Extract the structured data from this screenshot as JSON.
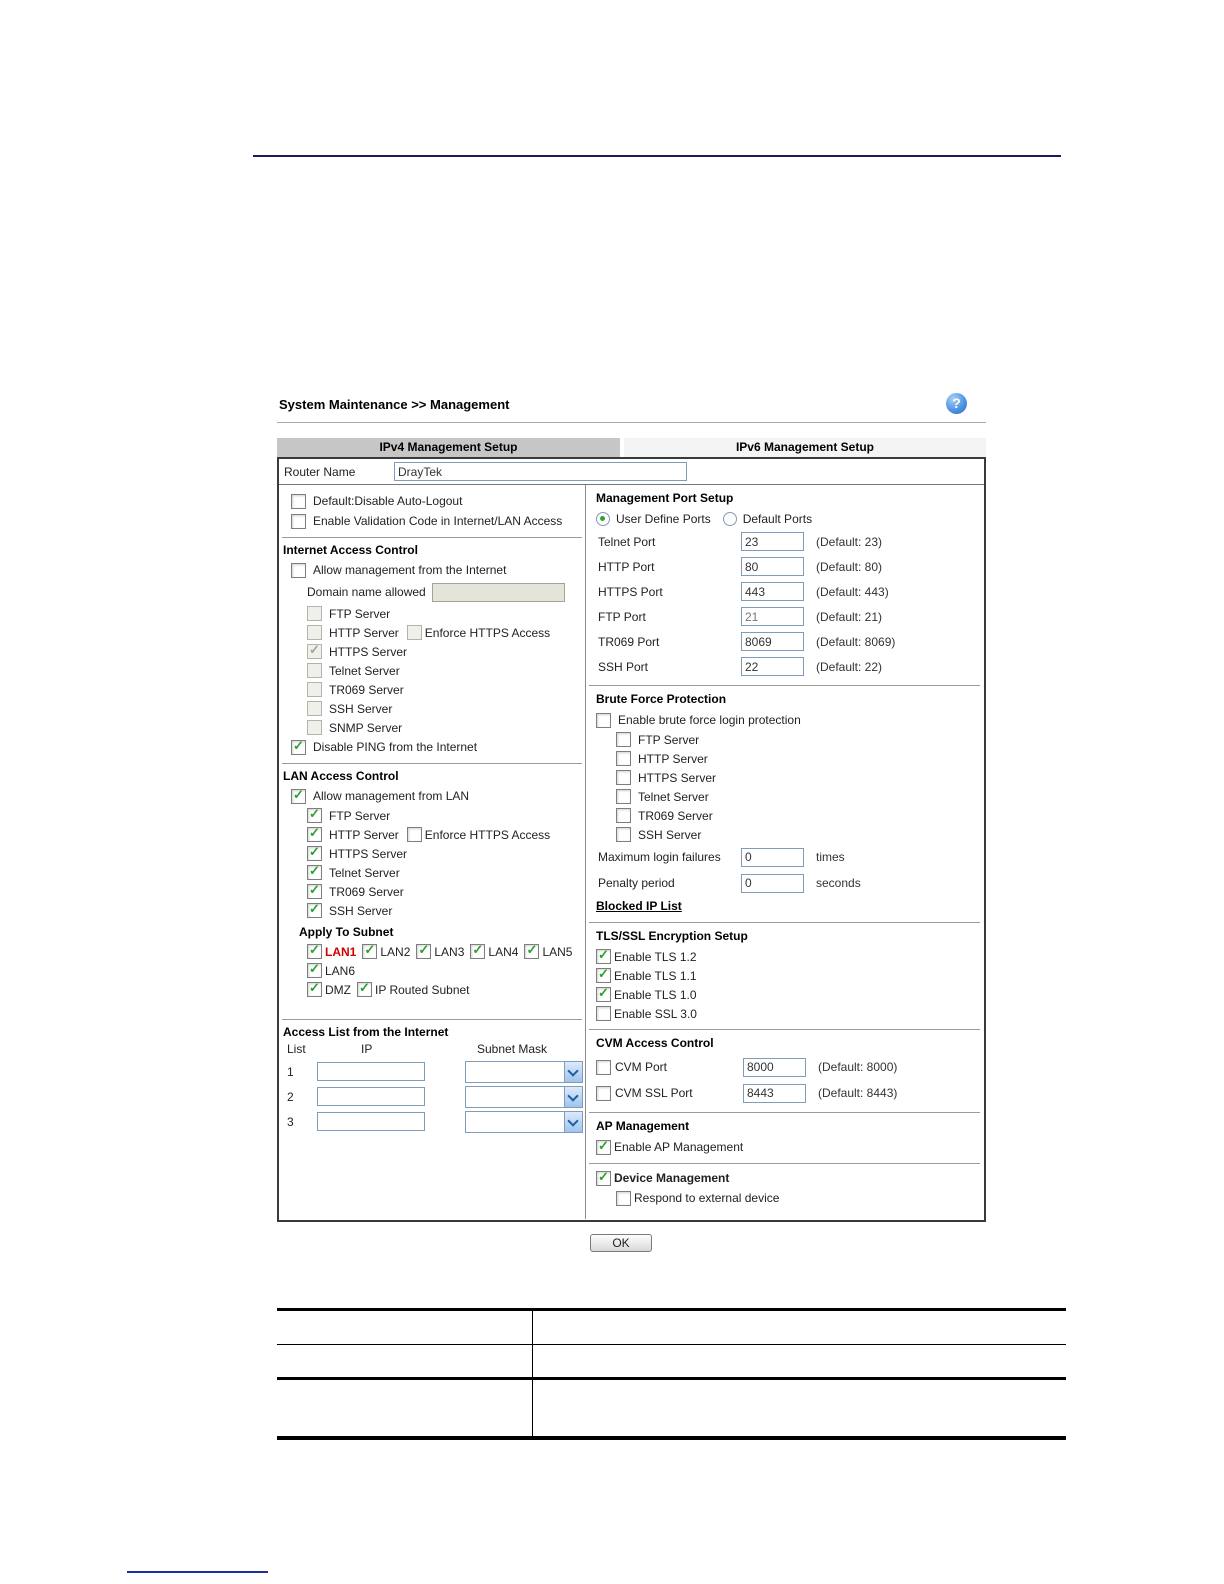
{
  "app": {
    "breadcrumb": "System Maintenance >> Management",
    "help": "?",
    "tabs": [
      {
        "label": "IPv4 Management Setup",
        "active": true
      },
      {
        "label": "IPv6 Management Setup",
        "active": false
      }
    ],
    "router_name": {
      "label": "Router Name",
      "value": "DrayTek"
    },
    "left": {
      "top_options": [
        {
          "label": "Default:Disable Auto-Logout",
          "checked": false
        },
        {
          "label": "Enable Validation Code in Internet/LAN Access",
          "checked": false
        }
      ],
      "internet_access": {
        "title": "Internet Access Control",
        "allow_label": "Allow management from the Internet",
        "allow_checked": false,
        "domain_label": "Domain name allowed",
        "domain_value": "",
        "servers": [
          {
            "label": "FTP Server",
            "checked": false,
            "disabled": true
          },
          {
            "label": "HTTP Server",
            "checked": false,
            "disabled": true,
            "extra": "Enforce HTTPS Access",
            "extra_checked": false
          },
          {
            "label": "HTTPS Server",
            "checked": true,
            "disabled": true
          },
          {
            "label": "Telnet Server",
            "checked": false,
            "disabled": true
          },
          {
            "label": "TR069 Server",
            "checked": false,
            "disabled": true
          },
          {
            "label": "SSH Server",
            "checked": false,
            "disabled": true
          },
          {
            "label": "SNMP Server",
            "checked": false,
            "disabled": true
          }
        ],
        "disable_ping_label": "Disable PING from the Internet",
        "disable_ping_checked": true
      },
      "lan_access": {
        "title": "LAN Access Control",
        "allow_label": "Allow management from LAN",
        "allow_checked": true,
        "servers": [
          {
            "label": "FTP Server",
            "checked": true
          },
          {
            "label": "HTTP Server",
            "checked": true,
            "extra": "Enforce HTTPS Access",
            "extra_checked": false
          },
          {
            "label": "HTTPS Server",
            "checked": true
          },
          {
            "label": "Telnet Server",
            "checked": true
          },
          {
            "label": "TR069 Server",
            "checked": true
          },
          {
            "label": "SSH Server",
            "checked": true
          }
        ],
        "apply_title": "Apply To Subnet",
        "subnet_rows": [
          {
            "items": [
              {
                "label": "LAN1",
                "checked": true,
                "highlight": true
              },
              {
                "label": "LAN2",
                "checked": true
              },
              {
                "label": "LAN3",
                "checked": true
              },
              {
                "label": "LAN4",
                "checked": true
              },
              {
                "label": "LAN5",
                "checked": true
              }
            ]
          },
          {
            "items": [
              {
                "label": "LAN6",
                "checked": true
              }
            ]
          },
          {
            "items": [
              {
                "label": "DMZ",
                "checked": true
              },
              {
                "label": "IP Routed Subnet",
                "checked": true
              }
            ]
          }
        ]
      },
      "access_list": {
        "title": "Access List from the Internet",
        "col_list": "List",
        "col_ip": "IP",
        "col_mask": "Subnet Mask",
        "rows": [
          {
            "index": "1",
            "ip": "",
            "mask": ""
          },
          {
            "index": "2",
            "ip": "",
            "mask": ""
          },
          {
            "index": "3",
            "ip": "",
            "mask": ""
          }
        ]
      }
    },
    "right": {
      "port_setup": {
        "title": "Management Port Setup",
        "radio_user": "User Define Ports",
        "radio_user_selected": true,
        "radio_default": "Default Ports",
        "radio_default_selected": false,
        "ports": [
          {
            "label": "Telnet Port",
            "value": "23",
            "hint": "(Default: 23)"
          },
          {
            "label": "HTTP Port",
            "value": "80",
            "hint": "(Default: 80)"
          },
          {
            "label": "HTTPS Port",
            "value": "443",
            "hint": "(Default: 443)"
          },
          {
            "label": "FTP Port",
            "value": "21",
            "hint": "(Default: 21)"
          },
          {
            "label": "TR069 Port",
            "value": "8069",
            "hint": "(Default: 8069)"
          },
          {
            "label": "SSH Port",
            "value": "22",
            "hint": "(Default: 22)"
          }
        ]
      },
      "brute_force": {
        "title": "Brute Force Protection",
        "enable_label": "Enable brute force login protection",
        "enable_checked": false,
        "servers": [
          {
            "label": "FTP Server",
            "checked": false
          },
          {
            "label": "HTTP Server",
            "checked": false
          },
          {
            "label": "HTTPS Server",
            "checked": false
          },
          {
            "label": "Telnet Server",
            "checked": false
          },
          {
            "label": "TR069 Server",
            "checked": false
          },
          {
            "label": "SSH Server",
            "checked": false
          }
        ],
        "fields": [
          {
            "label": "Maximum login failures",
            "value": "0",
            "unit": "times"
          },
          {
            "label": "Penalty period",
            "value": "0",
            "unit": "seconds"
          }
        ],
        "blocked_link": "Blocked IP List"
      },
      "tls": {
        "title": "TLS/SSL Encryption Setup",
        "options": [
          {
            "label": "Enable TLS 1.2",
            "checked": true
          },
          {
            "label": "Enable TLS 1.1",
            "checked": true
          },
          {
            "label": "Enable TLS 1.0",
            "checked": true
          },
          {
            "label": "Enable SSL 3.0",
            "checked": false
          }
        ]
      },
      "cvm": {
        "title": "CVM Access Control",
        "rows": [
          {
            "label": "CVM Port",
            "checked": false,
            "value": "8000",
            "hint": "(Default: 8000)"
          },
          {
            "label": "CVM SSL Port",
            "checked": false,
            "value": "8443",
            "hint": "(Default: 8443)"
          }
        ]
      },
      "ap": {
        "title": "AP Management",
        "enable_label": "Enable AP Management",
        "enable_checked": true
      },
      "device": {
        "title": "Device Management",
        "checked": true,
        "respond_label": "Respond to external device",
        "respond_checked": false
      }
    },
    "ok_label": "OK"
  },
  "bottom_table": {
    "rows": [
      [
        "",
        ""
      ],
      [
        "",
        ""
      ],
      [
        "",
        ""
      ]
    ]
  }
}
